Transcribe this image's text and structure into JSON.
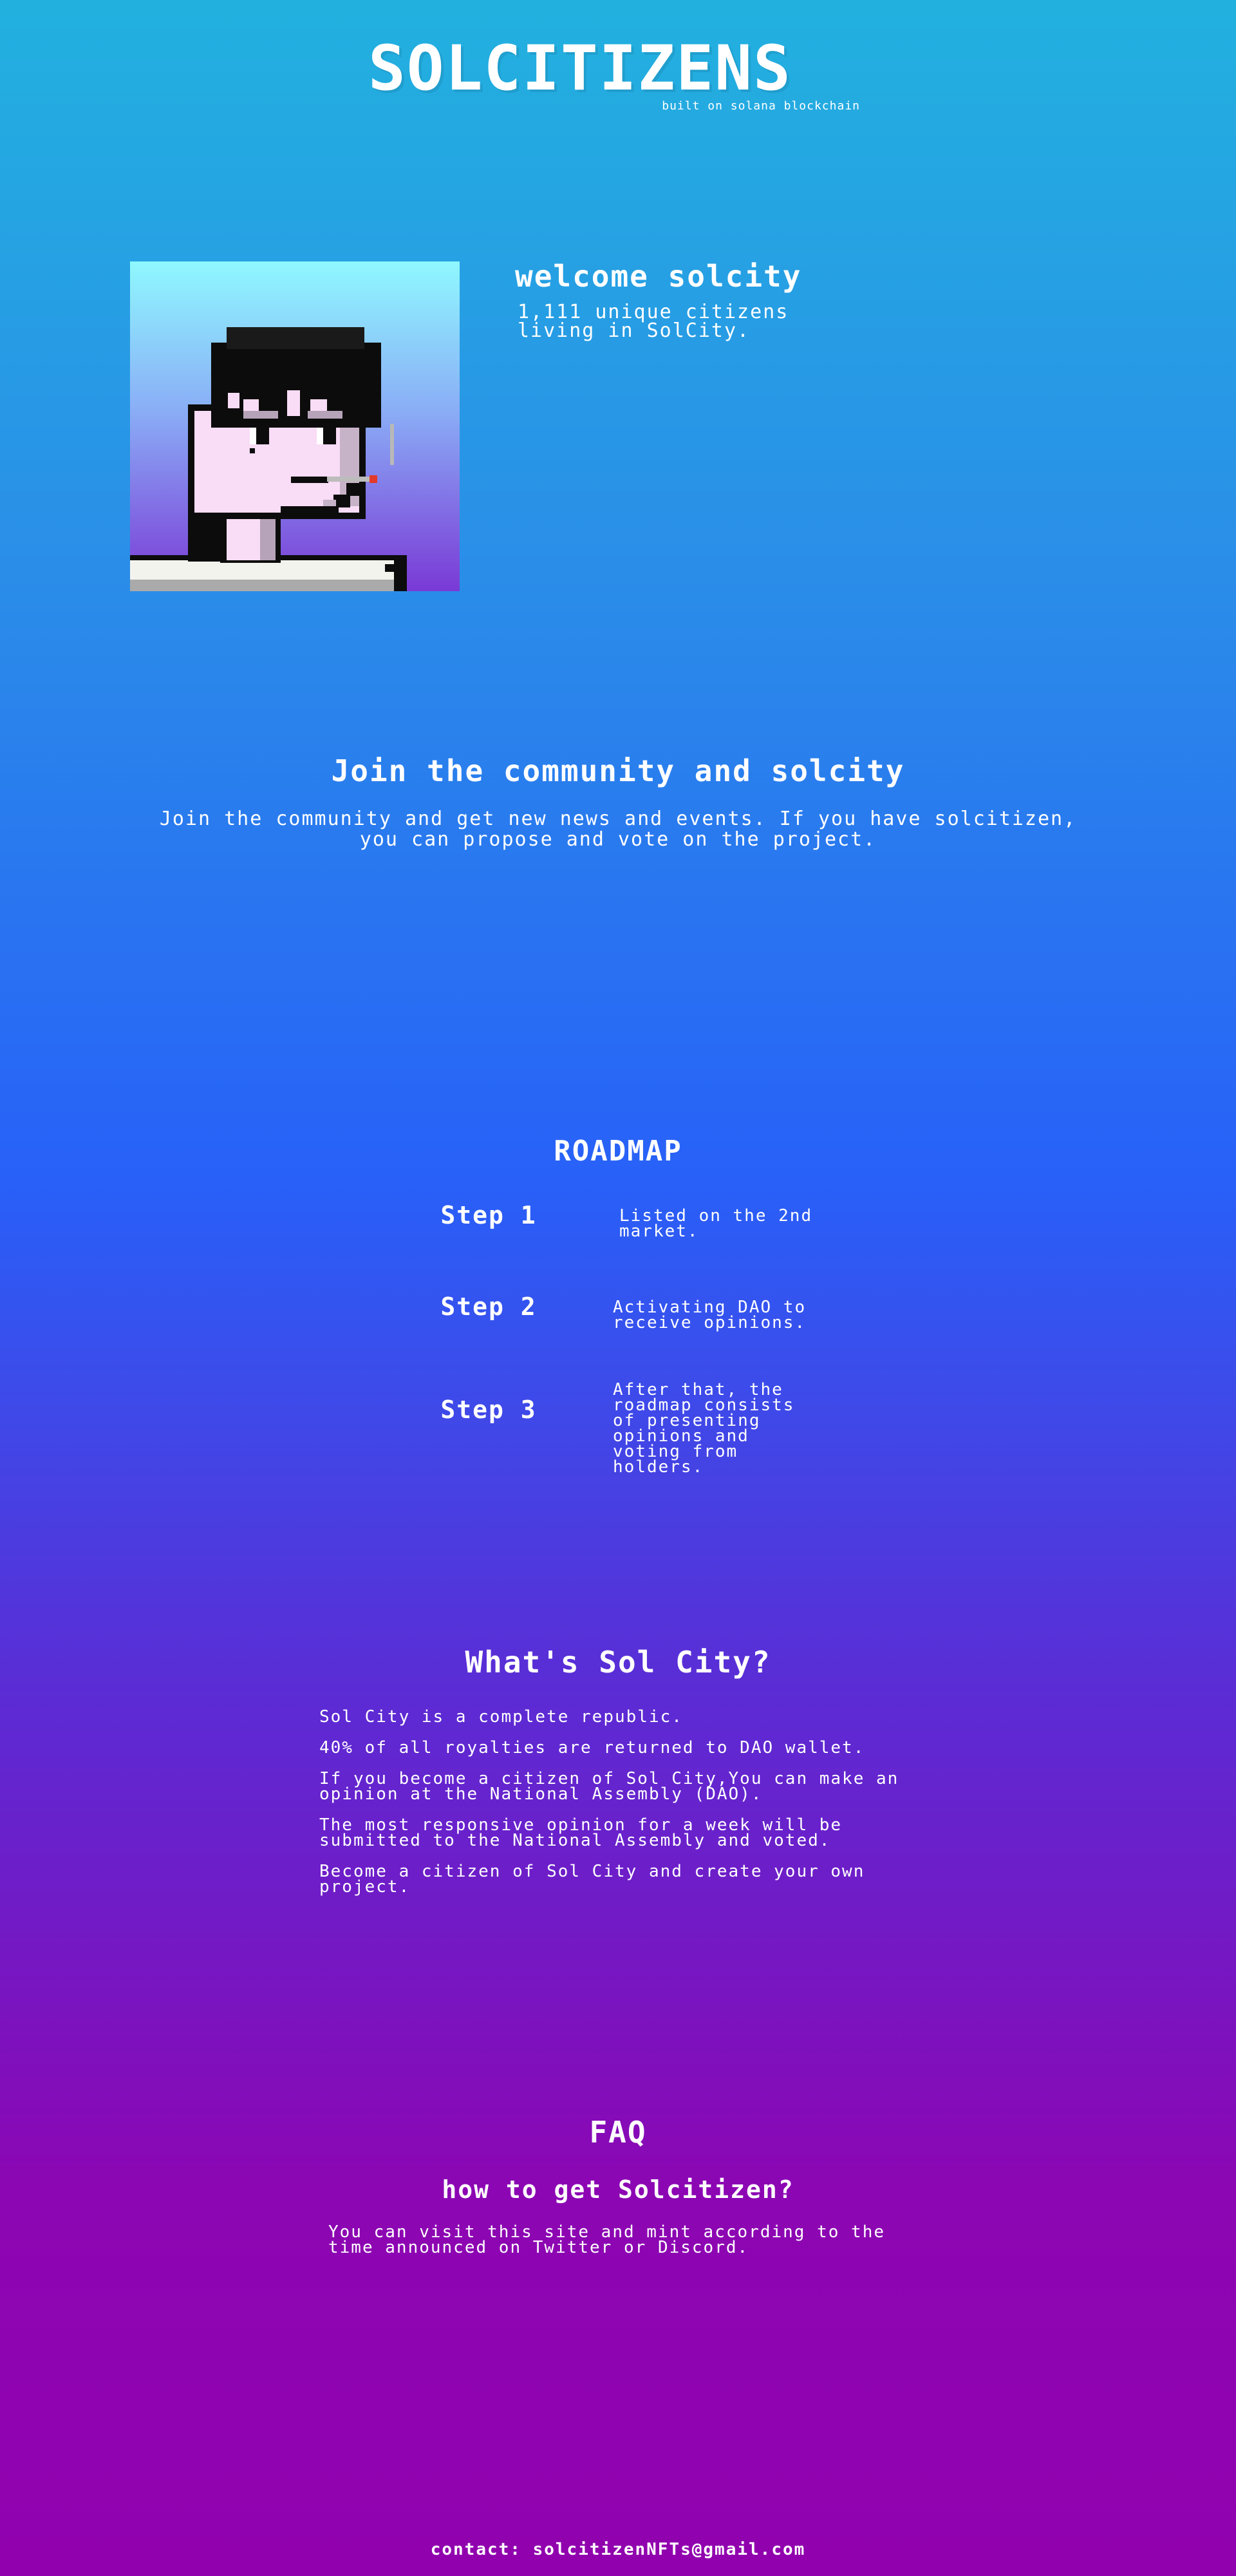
{
  "header": {
    "title": "SOLCITIZENS",
    "tagline": "built on solana blockchain"
  },
  "welcome": {
    "heading": "welcome solcity",
    "text": "1,111 unique citizens living in SolCity."
  },
  "community": {
    "heading": "Join the community and solcity",
    "text": "Join the community and get new news and events. If you have solcitizen, you can propose and vote on the project."
  },
  "roadmap": {
    "heading": "ROADMAP",
    "steps": [
      {
        "label": "Step 1",
        "text": "Listed on the 2nd market."
      },
      {
        "label": "Step 2",
        "text": "Activating DAO to receive opinions."
      },
      {
        "label": "Step 3",
        "text": "After that, the roadmap consists of presenting opinions and voting from holders."
      }
    ]
  },
  "about": {
    "heading": "What's Sol City?",
    "items": [
      "Sol City is a complete republic.",
      "40% of all royalties are returned to DAO wallet.",
      "If you become a citizen of Sol City,You can make an opinion at the National Assembly (DAO).",
      "The most responsive opinion for a week will be submitted to the National Assembly and voted.",
      "Become a citizen of Sol City and create your own project."
    ]
  },
  "faq": {
    "heading": "FAQ",
    "question": "how to get Solcitizen?",
    "answer": "You can visit this site and mint according to the time announced on Twitter or Discord."
  },
  "footer": {
    "contact_label": "contact:",
    "email": "solcitizenNFTs@gmail.com"
  },
  "colors": {
    "gradient_top": "#22b1df",
    "gradient_mid": "#2860f8",
    "gradient_bottom": "#9102ae",
    "text": "#ffffff"
  },
  "icons": {
    "avatar": "pixel-citizen-avatar"
  }
}
